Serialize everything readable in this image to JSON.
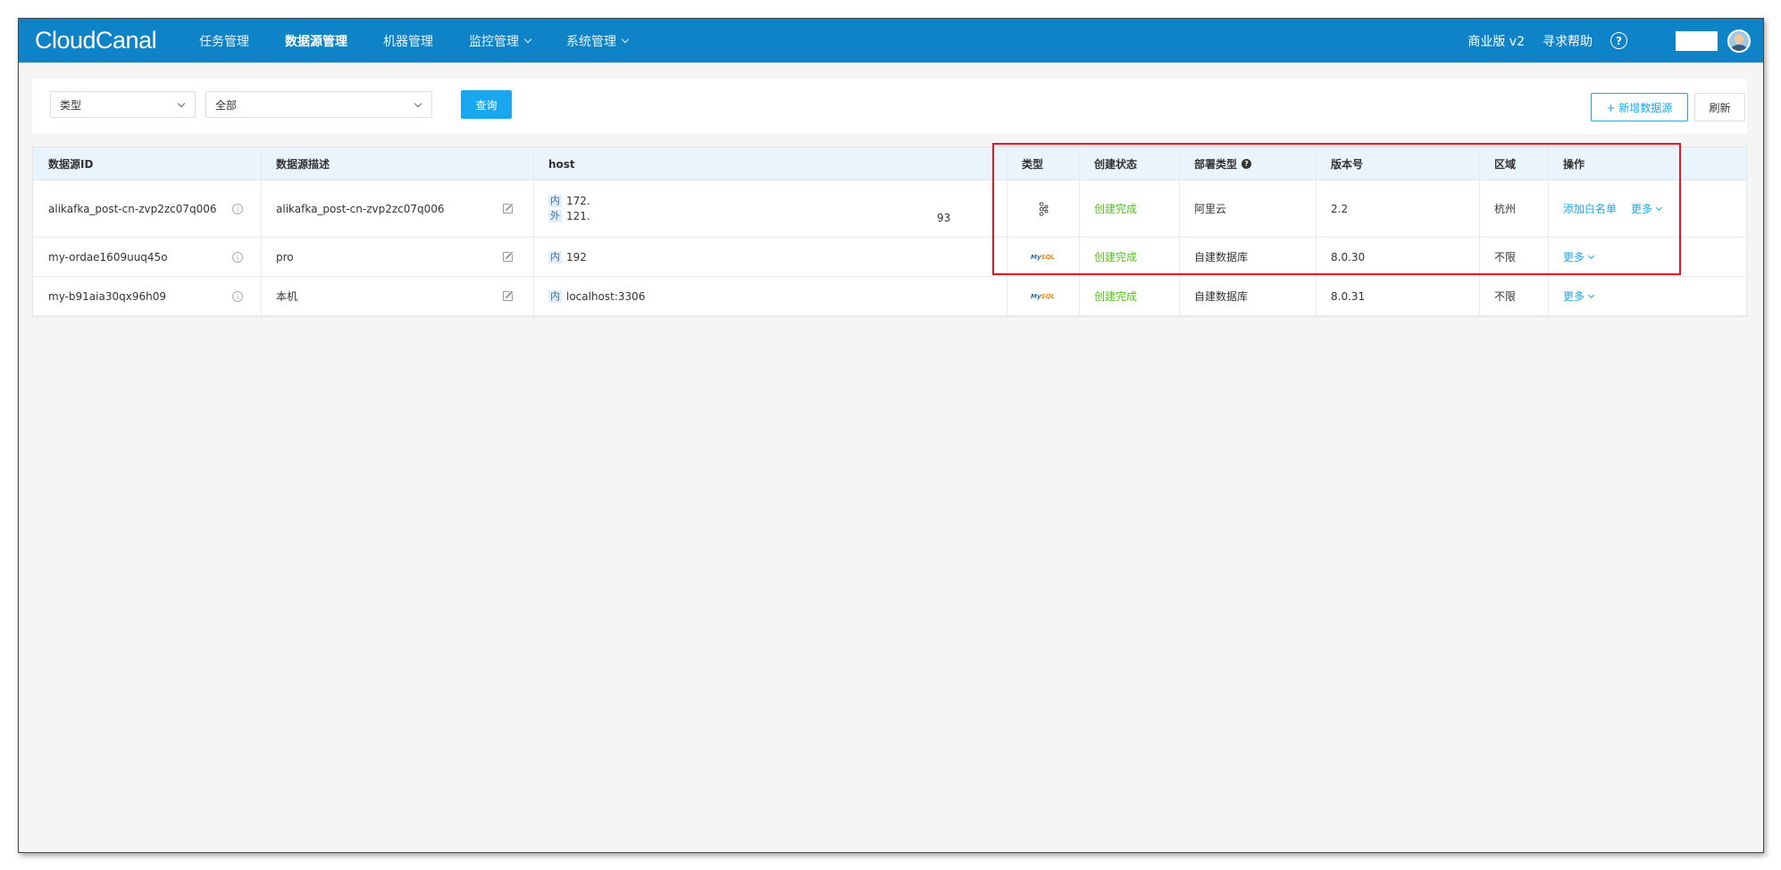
{
  "app": {
    "logo_text": "CloudCanal"
  },
  "nav": {
    "items": [
      {
        "label": "任务管理",
        "active": false,
        "dropdown": false
      },
      {
        "label": "数据源管理",
        "active": true,
        "dropdown": false
      },
      {
        "label": "机器管理",
        "active": false,
        "dropdown": false
      },
      {
        "label": "监控管理",
        "active": false,
        "dropdown": true
      },
      {
        "label": "系统管理",
        "active": false,
        "dropdown": true
      }
    ],
    "edition": "商业版 v2",
    "help": "寻求帮助",
    "help_icon": "?"
  },
  "filter": {
    "type_select": "类型",
    "value_select": "全部",
    "query_button": "查询",
    "add_button": "+ 新增数据源",
    "refresh_button": "刷新"
  },
  "table": {
    "headers": {
      "id": "数据源ID",
      "desc": "数据源描述",
      "host": "host",
      "type": "类型",
      "status": "创建状态",
      "deploy": "部署类型",
      "deploy_help": "?",
      "version": "版本号",
      "region": "区域",
      "actions": "操作"
    },
    "rows": [
      {
        "id": "alikafka_post-cn-zvp2zc07q006",
        "desc": "alikafka_post-cn-zvp2zc07q006",
        "host_inner_tag": "内",
        "host_inner": "172.",
        "host_outer_tag": "外",
        "host_outer": "121.",
        "host_outer_tail": "93",
        "type_icon": "kafka-icon",
        "status": "创建完成",
        "deploy": "阿里云",
        "version": "2.2",
        "region": "杭州",
        "action_primary": "添加白名单",
        "action_more": "更多"
      },
      {
        "id": "my-ordae1609uuq45o",
        "desc": "pro",
        "host_inner_tag": "内",
        "host_inner": "192",
        "type_icon": "mysql-icon",
        "status": "创建完成",
        "deploy": "自建数据库",
        "version": "8.0.30",
        "region": "不限",
        "action_more": "更多"
      },
      {
        "id": "my-b91aia30qx96h09",
        "desc": "本机",
        "host_inner_tag": "内",
        "host_inner": "localhost:3306",
        "type_icon": "mysql-icon",
        "status": "创建完成",
        "deploy": "自建数据库",
        "version": "8.0.31",
        "region": "不限",
        "action_more": "更多"
      }
    ]
  },
  "colors": {
    "topbar": "#0e83c7",
    "primary": "#19a8f0",
    "success": "#52c41a",
    "highlight": "#e8141e"
  }
}
